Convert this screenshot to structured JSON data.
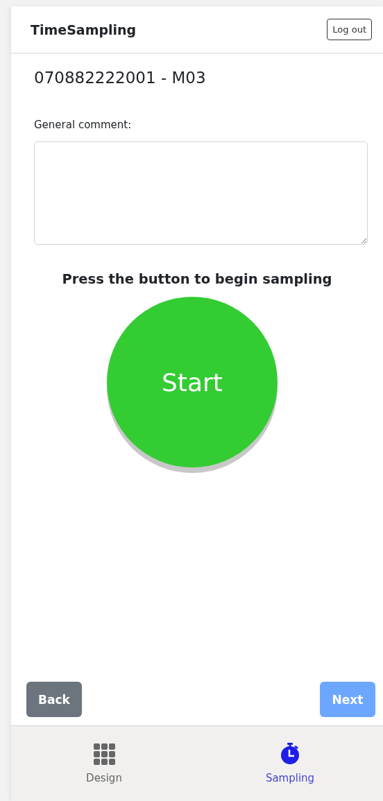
{
  "app": {
    "title": "TimeSampling",
    "logout": "Log out"
  },
  "heading": "070882222001 - M03",
  "comment": {
    "label": "General comment:"
  },
  "prompt": "Press the button to begin sampling",
  "start_button": "Start",
  "buttons": [
    {
      "label": "Back",
      "kind": "back",
      "disabled": false
    },
    {
      "label": "Next",
      "kind": "next",
      "disabled": true
    }
  ],
  "nav": [
    {
      "label": "Design",
      "kind": "grid",
      "selected": false
    },
    {
      "label": "Sampling",
      "kind": "stopwatch",
      "selected": true
    }
  ]
}
